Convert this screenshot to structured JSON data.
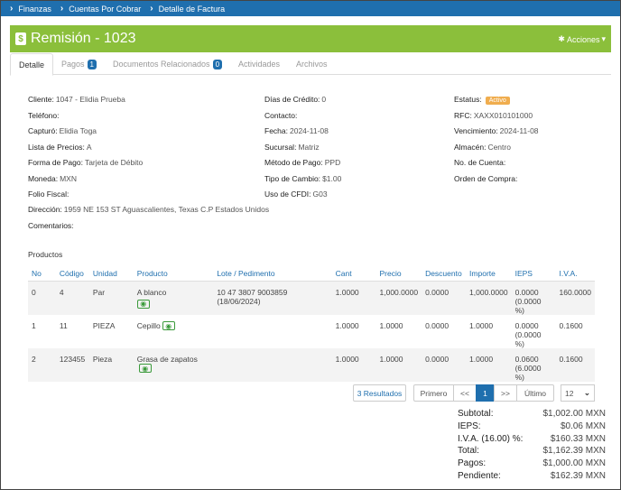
{
  "breadcrumb": [
    "Finanzas",
    "Cuentas Por Cobrar",
    "Detalle de Factura"
  ],
  "title": "Remisión - 1023",
  "actions_label": "Acciones",
  "tabs": [
    {
      "label": "Detalle"
    },
    {
      "label": "Pagos",
      "badge": "1"
    },
    {
      "label": "Documentos Relacionados",
      "badge": "0"
    },
    {
      "label": "Actividades"
    },
    {
      "label": "Archivos"
    }
  ],
  "fields": {
    "cliente": {
      "label": "Cliente:",
      "value": "1047 - Elidia Prueba"
    },
    "telefono": {
      "label": "Teléfono:",
      "value": ""
    },
    "capturo": {
      "label": "Capturó:",
      "value": "Elidia Toga"
    },
    "lista_precios": {
      "label": "Lista de Precios:",
      "value": "A"
    },
    "forma_pago": {
      "label": "Forma de Pago:",
      "value": "Tarjeta de Débito"
    },
    "moneda": {
      "label": "Moneda:",
      "value": "MXN"
    },
    "folio_fiscal": {
      "label": "Folio Fiscal:",
      "value": ""
    },
    "direccion": {
      "label": "Dirección:",
      "value": "1959 NE 153 ST Aguascalientes, Texas C.P Estados Unidos"
    },
    "comentarios": {
      "label": "Comentarios:",
      "value": ""
    },
    "dias_credito": {
      "label": "Días de Crédito:",
      "value": "0"
    },
    "contacto": {
      "label": "Contacto:",
      "value": ""
    },
    "fecha": {
      "label": "Fecha:",
      "value": "2024-11-08"
    },
    "sucursal": {
      "label": "Sucursal:",
      "value": "Matriz"
    },
    "metodo_pago": {
      "label": "Método de Pago:",
      "value": "PPD"
    },
    "tipo_cambio": {
      "label": "Tipo de Cambio:",
      "value": "$1.00"
    },
    "uso_cfdi": {
      "label": "Uso de CFDI:",
      "value": "G03"
    },
    "estatus": {
      "label": "Estatus:",
      "value": "Activo"
    },
    "rfc": {
      "label": "RFC:",
      "value": "XAXX010101000"
    },
    "vencimiento": {
      "label": "Vencimiento:",
      "value": "2024-11-08"
    },
    "almacen": {
      "label": "Almacén:",
      "value": "Centro"
    },
    "no_cuenta": {
      "label": "No. de Cuenta:",
      "value": ""
    },
    "orden_compra": {
      "label": "Orden de Compra:",
      "value": ""
    }
  },
  "products_title": "Productos",
  "columns": [
    "No",
    "Código",
    "Unidad",
    "Producto",
    "Lote / Pedimento",
    "Cant",
    "Precio",
    "Descuento",
    "Importe",
    "IEPS",
    "I.V.A."
  ],
  "rows": [
    {
      "no": "0",
      "codigo": "4",
      "unidad": "Par",
      "producto": "A blanco",
      "lote": "10 47 3807 9003859 (18/06/2024)",
      "cant": "1.0000",
      "precio": "1,000.0000",
      "descuento": "0.0000",
      "importe": "1,000.0000",
      "ieps": "0.0000",
      "ieps_pct": "(0.0000 %)",
      "iva": "160.0000"
    },
    {
      "no": "1",
      "codigo": "11",
      "unidad": "PIEZA",
      "producto": "Cepillo",
      "lote": "",
      "cant": "1.0000",
      "precio": "1.0000",
      "descuento": "0.0000",
      "importe": "1.0000",
      "ieps": "0.0000",
      "ieps_pct": "(0.0000 %)",
      "iva": "0.1600"
    },
    {
      "no": "2",
      "codigo": "123455",
      "unidad": "Pieza",
      "producto": "Grasa de zapatos",
      "lote": "",
      "cant": "1.0000",
      "precio": "1.0000",
      "descuento": "0.0000",
      "importe": "1.0000",
      "ieps": "0.0600",
      "ieps_pct": "(6.0000 %)",
      "iva": "0.1600"
    }
  ],
  "pagination": {
    "results": "3 Resultados",
    "first": "Primero",
    "prev": "<<",
    "current": "1",
    "next": ">>",
    "last": "Último",
    "per_page": "12"
  },
  "totals": [
    {
      "label": "Subtotal:",
      "value": "$1,002.00 MXN"
    },
    {
      "label": "IEPS:",
      "value": "$0.06 MXN"
    },
    {
      "label": "I.V.A. (16.00) %:",
      "value": "$160.33 MXN"
    },
    {
      "label": "Total:",
      "value": "$1,162.39 MXN"
    },
    {
      "label": "Pagos:",
      "value": "$1,000.00 MXN"
    },
    {
      "label": "Pendiente:",
      "value": "$162.39 MXN"
    }
  ],
  "colors": {
    "header": "#1f6fae",
    "title_bar": "#8bbf3b",
    "status": "#f0ad4e"
  }
}
